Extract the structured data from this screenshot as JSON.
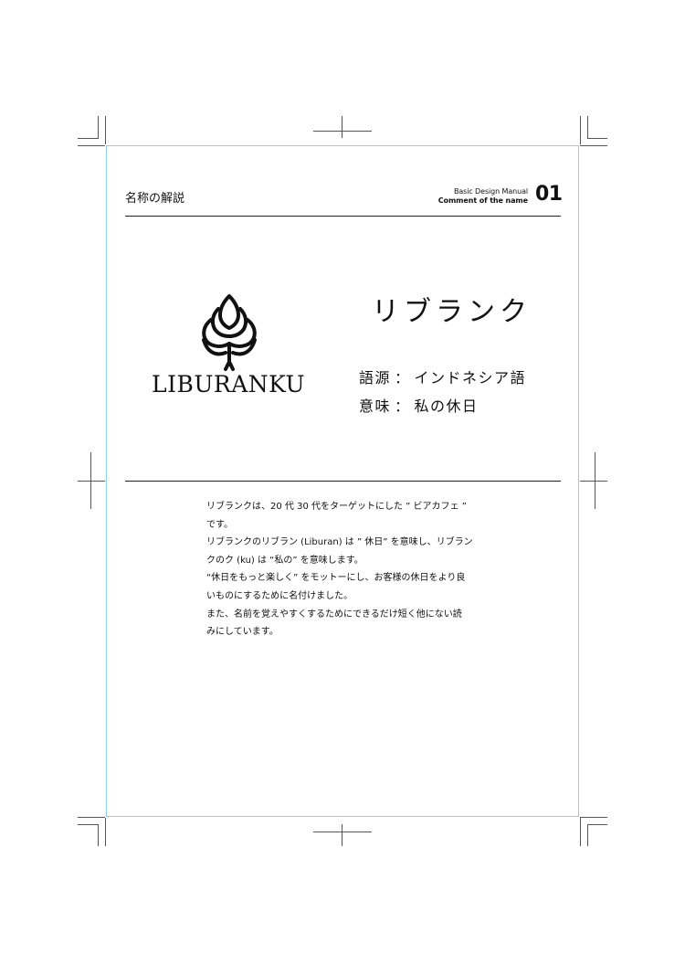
{
  "header": {
    "title": "名称の解説",
    "manual_line1": "Basic Design Manual",
    "manual_line2": "Comment of the name",
    "page_number": "01"
  },
  "logo": {
    "icon": "artichoke-leaf-icon",
    "wordmark": "LIBURANKU"
  },
  "brand": {
    "kana": "リブランク",
    "facts": [
      {
        "label": "語源",
        "separator": "：",
        "value": "インドネシア語"
      },
      {
        "label": "意味",
        "separator": "：",
        "value": "私の休日"
      }
    ]
  },
  "description": [
    "リブランクは、20 代 30 代をターゲットにした ” ビアカフェ ”",
    "です。",
    "リブランクのリブラン (Liburan) は ” 休日” を意味し、リブラン",
    "クのク (ku) は “私の” を意味します。",
    "“休日をもっと楽しく” をモットーにし、お客様の休日をより良",
    "いものにするために名付けました。",
    "また、名前を覚えやすくするためにできるだけ短く他にない読",
    "みにしています。"
  ],
  "colors": {
    "trim_line": "#8fd3e8",
    "text": "#111111",
    "crop_marks": "#555555"
  }
}
